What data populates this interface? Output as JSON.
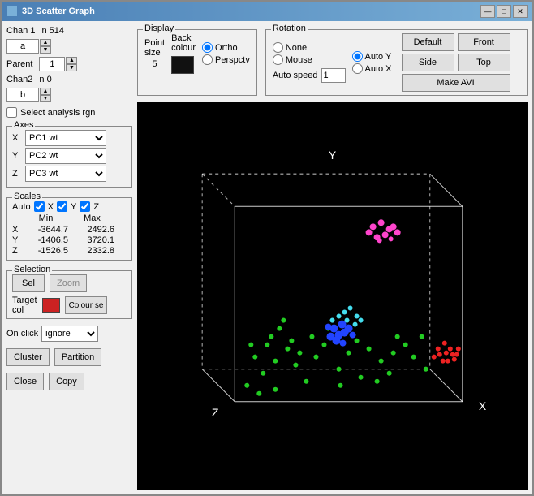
{
  "window": {
    "title": "3D Scatter Graph",
    "min_btn": "—",
    "max_btn": "□",
    "close_btn": "✕"
  },
  "left": {
    "chan1_label": "Chan 1",
    "chan1_n": "n  514",
    "chan1_val": "a",
    "parent_label": "Parent",
    "parent_val": "1",
    "chan2_label": "Chan2",
    "chan2_n": "n  0",
    "chan2_val": "b",
    "select_analysis": "Select analysis rgn",
    "axes_label": "Axes",
    "axis_x_label": "X",
    "axis_x_val": "PC1 wt",
    "axis_y_label": "Y",
    "axis_y_val": "PC2 wt",
    "axis_z_label": "Z",
    "axis_z_val": "PC3 wt",
    "scales_label": "Scales",
    "auto_label": "Auto",
    "auto_x_checked": true,
    "auto_y_checked": true,
    "auto_z_checked": true,
    "min_label": "Min",
    "max_label": "Max",
    "x_min": "-3644.7",
    "x_max": "2492.6",
    "y_min": "-1406.5",
    "y_max": "3720.1",
    "z_min": "-1526.5",
    "z_max": "2332.8",
    "selection_label": "Selection",
    "sel_btn": "Sel",
    "zoom_btn": "Zoom",
    "target_col_label": "Target\ncol",
    "colour_sel_btn": "Colour se",
    "on_click_label": "On click",
    "on_click_val": "ignore",
    "cluster_btn": "Cluster",
    "partition_btn": "Partition",
    "close_btn": "Close",
    "copy_btn": "Copy"
  },
  "display": {
    "label": "Display",
    "point_size_label": "Point\nsize",
    "point_size_val": "5",
    "back_colour_label": "Back\ncolour",
    "ortho_label": "Ortho",
    "persp_label": "Perspctv"
  },
  "rotation": {
    "label": "Rotation",
    "none_label": "None",
    "auto_y_label": "Auto Y",
    "mouse_label": "Mouse",
    "auto_x_label": "Auto X",
    "auto_speed_label": "Auto speed",
    "auto_speed_val": "1",
    "default_btn": "Default",
    "front_btn": "Front",
    "side_btn": "Side",
    "top_btn": "Top",
    "make_avi_btn": "Make AVI"
  }
}
